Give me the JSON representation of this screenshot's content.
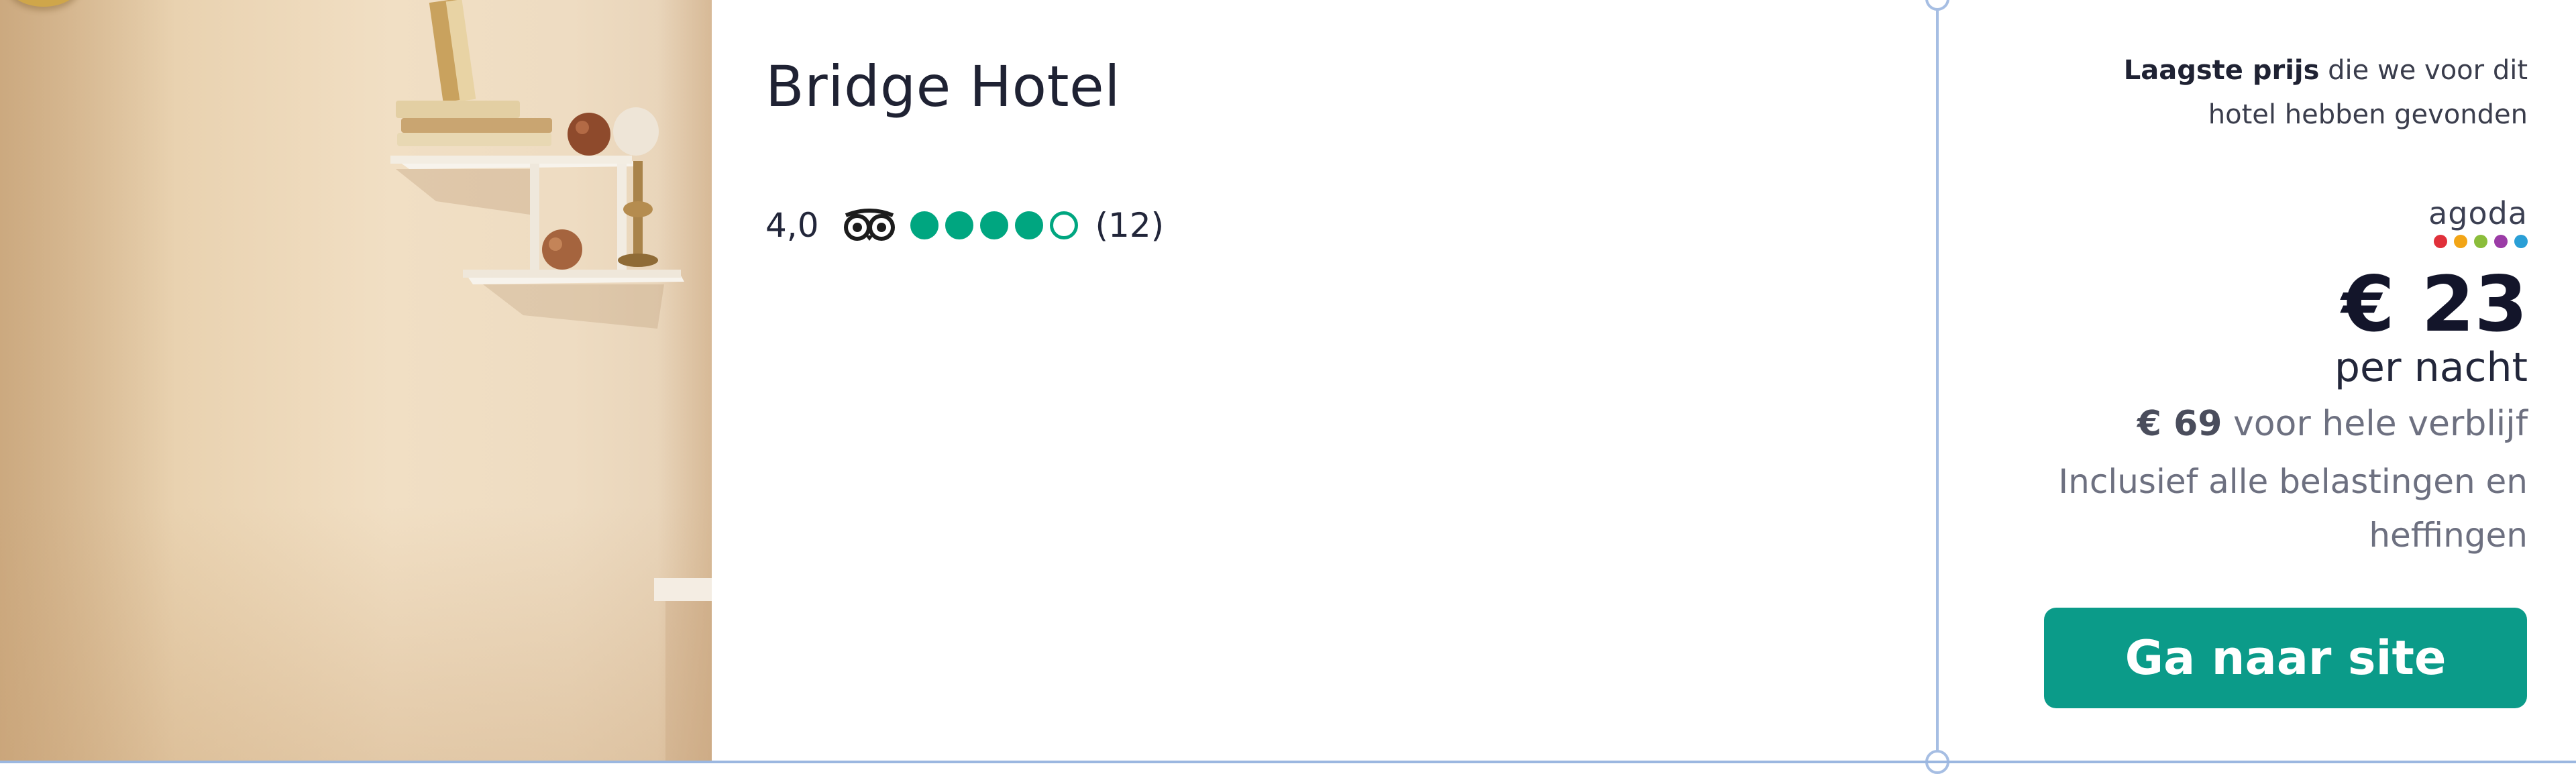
{
  "hotel": {
    "name": "Bridge Hotel",
    "rating_value": "4,0",
    "rating_bubbles": 4,
    "rating_max": 5,
    "review_count": "(12)"
  },
  "pricing": {
    "lowest_label_bold": "Laagste prijs",
    "lowest_label_rest": " die we voor dit hotel hebben gevonden",
    "provider": "agoda",
    "provider_dot_colors": [
      "#e0303a",
      "#f2a516",
      "#8bbd3b",
      "#9b3ca6",
      "#2a9fd6"
    ],
    "price": "€ 23",
    "per_night": "per nacht",
    "total_price": "€ 69",
    "total_label": " voor hele verblijf",
    "tax_note": "Inclusief alle belastingen en heffingen",
    "cta_label": "Ga naar site"
  },
  "colors": {
    "rating_green": "#00a680",
    "cta_teal": "#0b9b89",
    "divider_blue": "#a6bee3"
  },
  "icons": {
    "review_site": "tripadvisor-owl-icon"
  }
}
